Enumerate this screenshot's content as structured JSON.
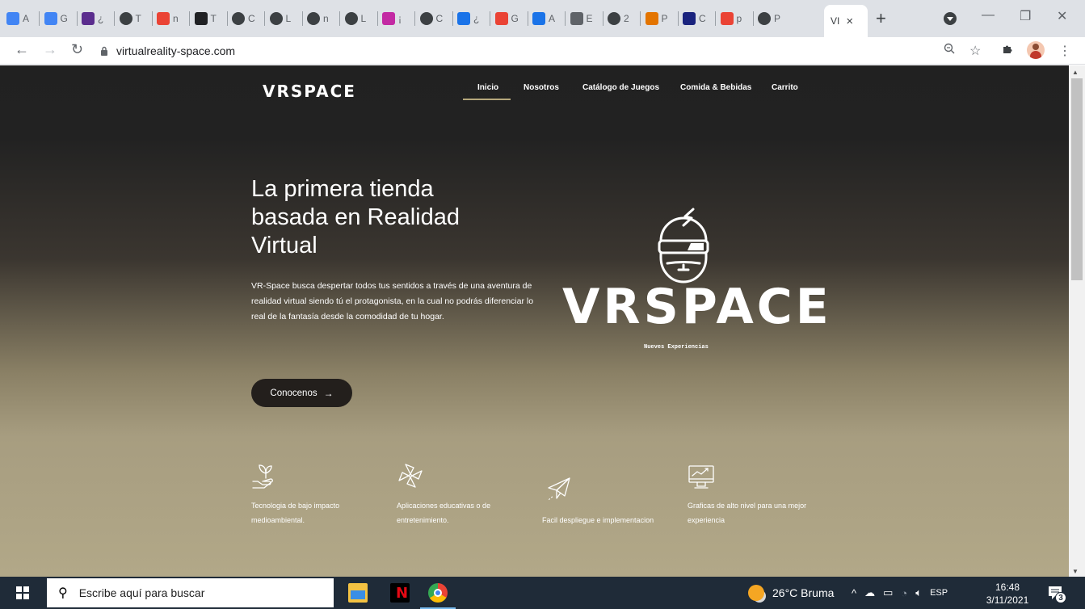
{
  "browser": {
    "tabs": [
      {
        "icon": "google-docs-icon",
        "letter": "A",
        "color": "#4285f4"
      },
      {
        "icon": "google-docs-icon",
        "letter": "G",
        "color": "#4285f4"
      },
      {
        "icon": "ebsco-icon",
        "letter": "¿",
        "color": "#5b2d8e"
      },
      {
        "icon": "globe-icon",
        "letter": "T",
        "color": "#3c4043"
      },
      {
        "icon": "google-icon",
        "letter": "n",
        "color": "#ea4335"
      },
      {
        "icon": "d-icon",
        "letter": "T",
        "color": "#202124"
      },
      {
        "icon": "globe-icon",
        "letter": "C",
        "color": "#3c4043"
      },
      {
        "icon": "globe-icon",
        "letter": "L",
        "color": "#3c4043"
      },
      {
        "icon": "globe-icon",
        "letter": "n",
        "color": "#3c4043"
      },
      {
        "icon": "globe-icon",
        "letter": "L",
        "color": "#3c4043"
      },
      {
        "icon": "s-icon",
        "letter": "¡",
        "color": "#c32aa3"
      },
      {
        "icon": "globe-icon",
        "letter": "C",
        "color": "#3c4043"
      },
      {
        "icon": "copilot-icon",
        "letter": "¿",
        "color": "#1a73e8"
      },
      {
        "icon": "google-icon",
        "letter": "G",
        "color": "#ea4335"
      },
      {
        "icon": "ex-icon",
        "letter": "A",
        "color": "#1a73e8"
      },
      {
        "icon": "tm-icon",
        "letter": "E",
        "color": "#5f6368"
      },
      {
        "icon": "globe-icon",
        "letter": "2",
        "color": "#3c4043"
      },
      {
        "icon": "colorful-icon",
        "letter": "P",
        "color": "#e37400"
      },
      {
        "icon": "mcm-icon",
        "letter": "C",
        "color": "#1a237e"
      },
      {
        "icon": "google-icon",
        "letter": "p",
        "color": "#ea4335"
      },
      {
        "icon": "globe-icon",
        "letter": "P",
        "color": "#3c4043"
      }
    ],
    "active_tab": {
      "title": "VI",
      "close": "×"
    },
    "new_tab": "+",
    "url": "virtualreality-space.com"
  },
  "site": {
    "logo": "VRSPACE",
    "nav": [
      {
        "label": "Inicio",
        "active": true
      },
      {
        "label": "Nosotros",
        "active": false
      },
      {
        "label": "Catálogo de Juegos",
        "active": false
      },
      {
        "label": "Comida & Bebidas",
        "active": false
      },
      {
        "label": "Carrito",
        "active": false
      }
    ],
    "hero": {
      "title": "La primera tienda basada en Realidad Virtual",
      "text": "VR-Space busca despertar todos tus sentidos a través de una aventura de realidad virtual siendo tú el protagonista, en la cual no podrás diferenciar lo real de la fantasía desde la comodidad de tu hogar.",
      "button": "Conocenos",
      "button_arrow": "→"
    },
    "big_logo": {
      "word": "VRSPACE",
      "tagline": "Nueves Experiencias"
    },
    "features": [
      {
        "icon": "eco-hand-plant-icon",
        "text": "Tecnologia de bajo impacto medioambiental."
      },
      {
        "icon": "pinwheel-icon",
        "text": "Aplicaciones educativas o de entretenimiento."
      },
      {
        "icon": "paper-plane-icon",
        "text": "Facil despliegue e implementacion"
      },
      {
        "icon": "monitor-chart-icon",
        "text": "Graficas de alto nivel para una mejor experiencia"
      }
    ]
  },
  "taskbar": {
    "search_placeholder": "Escribe aquí para buscar",
    "weather": "26°C  Bruma",
    "language": "ESP",
    "time": "16:48",
    "date": "3/11/2021",
    "notifications": "3"
  }
}
